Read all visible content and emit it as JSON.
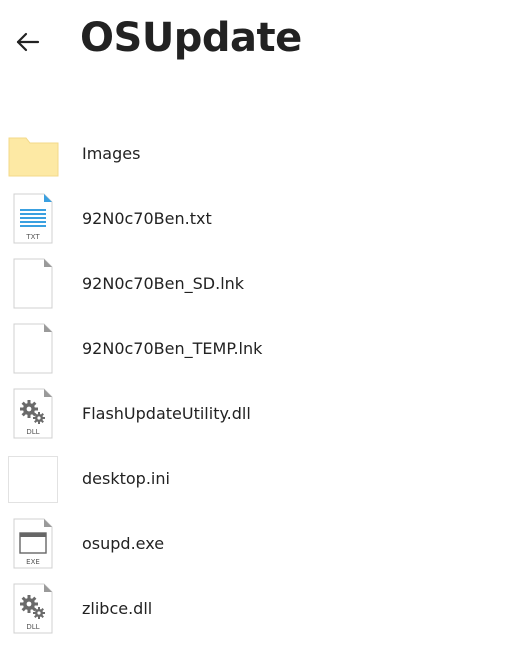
{
  "header": {
    "title": "OSUpdate"
  },
  "files": [
    {
      "name": "Images",
      "type": "folder"
    },
    {
      "name": "92N0c70Ben.txt",
      "type": "txt",
      "badge": "TXT"
    },
    {
      "name": "92N0c70Ben_SD.lnk",
      "type": "blank"
    },
    {
      "name": "92N0c70Ben_TEMP.lnk",
      "type": "blank"
    },
    {
      "name": "FlashUpdateUtility.dll",
      "type": "dll",
      "badge": "DLL"
    },
    {
      "name": "desktop.ini",
      "type": "ini"
    },
    {
      "name": "osupd.exe",
      "type": "exe",
      "badge": "EXE"
    },
    {
      "name": "zlibce.dll",
      "type": "dll",
      "badge": "DLL"
    }
  ],
  "colors": {
    "folder": "#fde9a4",
    "folder_stroke": "#f0d27a",
    "txt_accent": "#3aa0e0",
    "page_stroke": "#cfcfcf",
    "fold": "#9a9a9a"
  }
}
